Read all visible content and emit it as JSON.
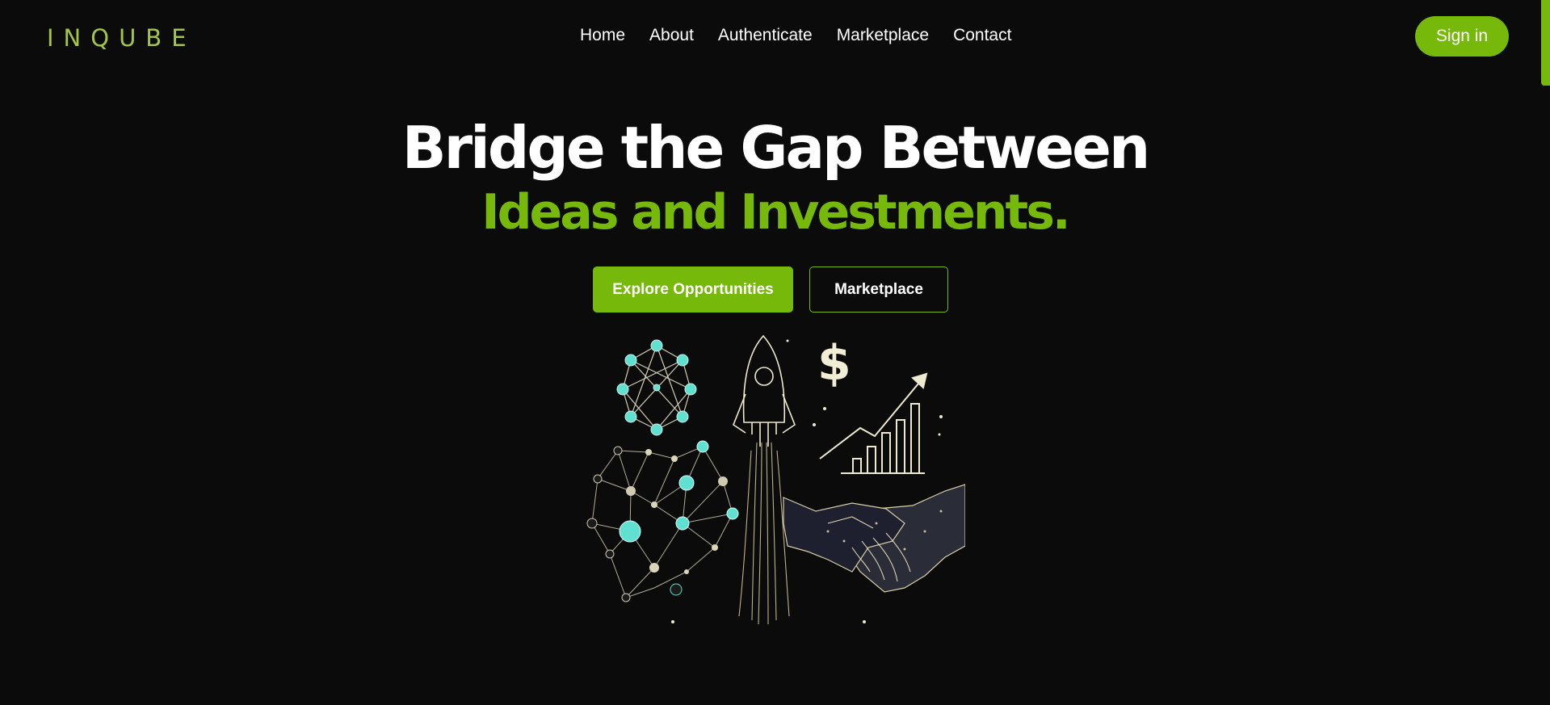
{
  "header": {
    "logo_text": "INQUBE",
    "nav": [
      "Home",
      "About",
      "Authenticate",
      "Marketplace",
      "Contact"
    ],
    "signin_label": "Sign in"
  },
  "hero": {
    "title": "Bridge the Gap Between",
    "subtitle": "Ideas and Investments.",
    "primary_button": "Explore Opportunities",
    "secondary_button": "Marketplace",
    "art_symbol": "$"
  },
  "colors": {
    "background": "#0b0b0c",
    "accent": "#76b90b",
    "logo": "#a4c545",
    "network_node": "#5fe0d0"
  }
}
